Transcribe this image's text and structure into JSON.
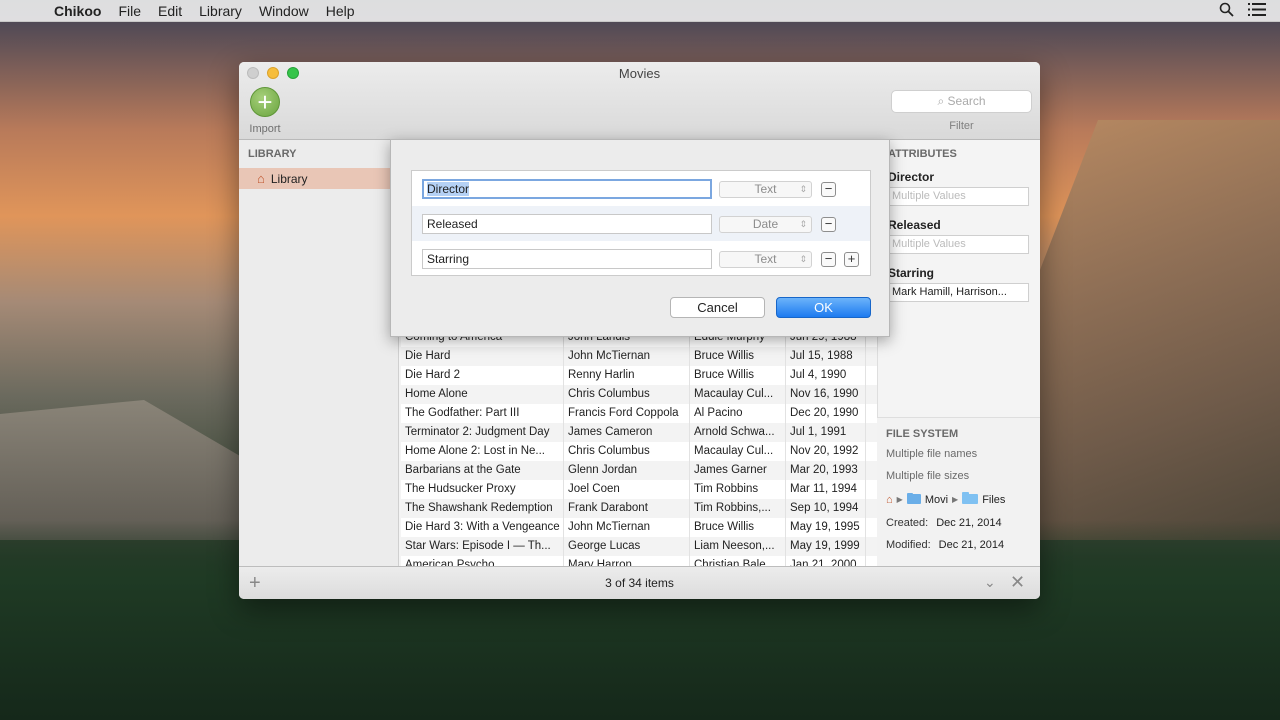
{
  "menubar": {
    "app_name": "Chikoo",
    "menus": [
      "File",
      "Edit",
      "Library",
      "Window",
      "Help"
    ]
  },
  "window": {
    "title": "Movies",
    "import_label": "Import",
    "search_placeholder": "Search",
    "filter_label": "Filter"
  },
  "sidebar": {
    "header": "LIBRARY",
    "item": "Library"
  },
  "table": {
    "rows": [
      [
        "Coming to America",
        "John Landis",
        "Eddie Murphy",
        "Jun 29, 1988"
      ],
      [
        "Die Hard",
        "John McTiernan",
        "Bruce Willis",
        "Jul 15, 1988"
      ],
      [
        "Die Hard 2",
        "Renny Harlin",
        "Bruce Willis",
        "Jul 4, 1990"
      ],
      [
        "Home Alone",
        "Chris Columbus",
        "Macaulay Cul...",
        "Nov 16, 1990"
      ],
      [
        "The Godfather: Part III",
        "Francis Ford Coppola",
        "Al Pacino",
        "Dec 20, 1990"
      ],
      [
        "Terminator 2: Judgment Day",
        "James Cameron",
        "Arnold Schwa...",
        "Jul 1, 1991"
      ],
      [
        "Home Alone 2: Lost in Ne...",
        "Chris Columbus",
        "Macaulay Cul...",
        "Nov 20, 1992"
      ],
      [
        "Barbarians at the Gate",
        "Glenn Jordan",
        "James Garner",
        "Mar 20, 1993"
      ],
      [
        "The Hudsucker Proxy",
        "Joel Coen",
        "Tim Robbins",
        "Mar 11, 1994"
      ],
      [
        "The Shawshank Redemption",
        "Frank Darabont",
        "Tim Robbins,...",
        "Sep 10, 1994"
      ],
      [
        "Die Hard 3: With a Vengeance",
        "John McTiernan",
        "Bruce Willis",
        "May 19, 1995"
      ],
      [
        "Star Wars: Episode I — Th...",
        "George Lucas",
        "Liam Neeson,...",
        "May 19, 1999"
      ],
      [
        "American Psycho",
        "Mary Harron",
        "Christian Bale",
        "Jan 21, 2000"
      ]
    ]
  },
  "attributes": {
    "header": "ATTRIBUTES",
    "fields": [
      {
        "label": "Director",
        "value": "Multiple Values",
        "filled": false
      },
      {
        "label": "Released",
        "value": "Multiple Values",
        "filled": false
      },
      {
        "label": "Starring",
        "value": "Mark Hamill, Harrison...",
        "filled": true
      }
    ]
  },
  "file_system": {
    "header": "FILE SYSTEM",
    "names": "Multiple file names",
    "sizes": "Multiple file sizes",
    "path_mid": "Movi",
    "path_end": "Files",
    "created_label": "Created:",
    "created_value": "Dec 21, 2014",
    "modified_label": "Modified:",
    "modified_value": "Dec 21, 2014"
  },
  "bottombar": {
    "count": "3 of 34 items"
  },
  "sheet": {
    "rows": [
      {
        "name": "Director",
        "type": "Text"
      },
      {
        "name": "Released",
        "type": "Date"
      },
      {
        "name": "Starring",
        "type": "Text"
      }
    ],
    "cancel": "Cancel",
    "ok": "OK"
  }
}
